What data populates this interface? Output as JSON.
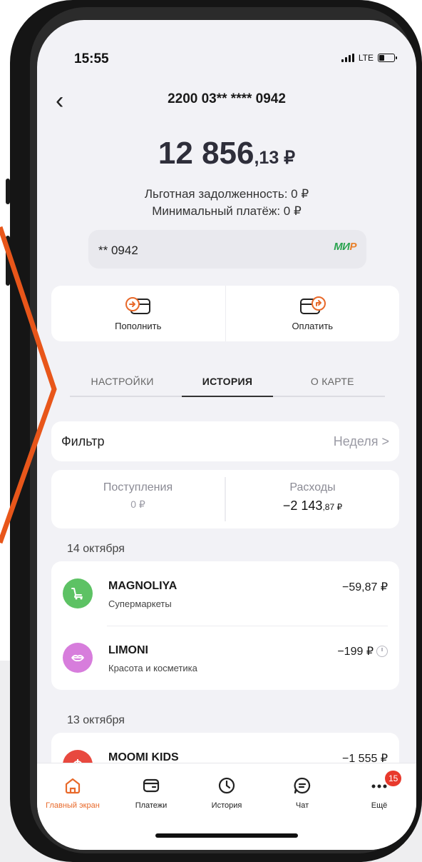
{
  "status": {
    "time": "15:55",
    "network": "LTE"
  },
  "header": {
    "card_number": "2200 03** **** 0942"
  },
  "balance": {
    "main": "12 856",
    "fraction": ",13 ₽"
  },
  "debt": {
    "grace": "Льготная задолженность: 0 ₽",
    "minimum": "Минимальный платёж: 0 ₽"
  },
  "mini_card": {
    "number": "** 0942",
    "system": "МИР"
  },
  "actions": {
    "topup": "Пополнить",
    "pay": "Оплатить"
  },
  "tabs": [
    {
      "label": "НАСТРОЙКИ"
    },
    {
      "label": "ИСТОРИЯ"
    },
    {
      "label": "О КАРТЕ"
    }
  ],
  "filter": {
    "label": "Фильтр",
    "value": "Неделя >"
  },
  "summary": {
    "income_title": "Поступления",
    "income_value": "0 ₽",
    "expense_title": "Расходы",
    "expense_value": "−2 143",
    "expense_fraction": ",87 ₽"
  },
  "groups": [
    {
      "date": "14 октября"
    },
    {
      "date": "13 октября"
    }
  ],
  "transactions": [
    {
      "name": "MAGNOLIYA",
      "category": "Супермаркеты",
      "amount": "−59,87 ₽",
      "color": "#5dc264"
    },
    {
      "name": "LIMONI",
      "category": "Красота и косметика",
      "amount": "−199 ₽",
      "color": "#d77ddc"
    },
    {
      "name": "MOOMI KIDS",
      "category": "",
      "amount": "−1 555 ₽",
      "color": "#e8493f"
    }
  ],
  "tabbar": [
    {
      "label": "Главный экран"
    },
    {
      "label": "Платежи"
    },
    {
      "label": "История"
    },
    {
      "label": "Чат"
    },
    {
      "label": "Ещё",
      "badge": "15"
    }
  ],
  "colors": {
    "accent": "#e8692a",
    "chevron": "#e8561a"
  }
}
